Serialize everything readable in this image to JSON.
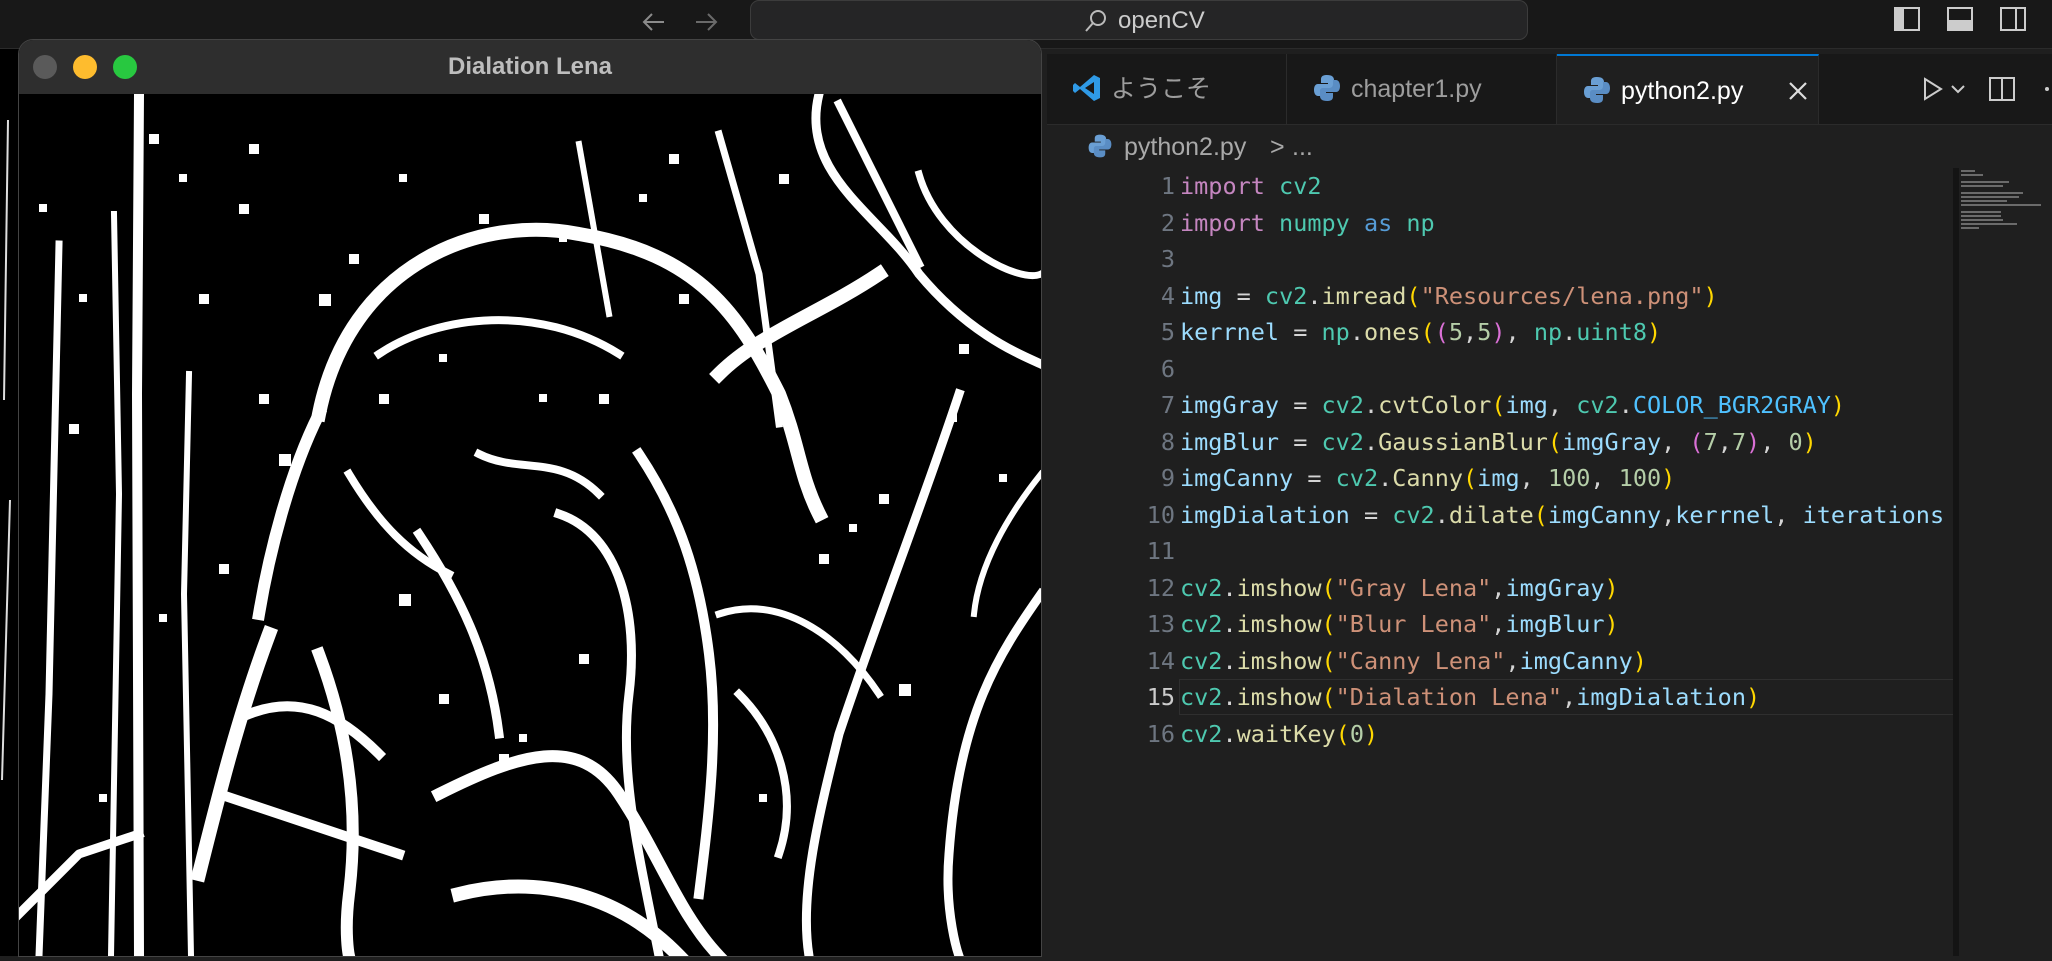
{
  "titlebar": {
    "search_text": "openCV"
  },
  "cv_window": {
    "title": "Dialation Lena"
  },
  "tabs": [
    {
      "label": "ようこそ",
      "icon": "vscode-logo-icon",
      "active": false
    },
    {
      "label": "chapter1.py",
      "icon": "python-file-icon",
      "active": false
    },
    {
      "label": "python2.py",
      "icon": "python-file-icon",
      "active": true
    }
  ],
  "breadcrumb": {
    "file": "python2.py",
    "separator": ">",
    "more": "..."
  },
  "editor": {
    "current_line": 15,
    "lines": [
      {
        "n": "1",
        "text": "import cv2"
      },
      {
        "n": "2",
        "text": "import numpy as np"
      },
      {
        "n": "3",
        "text": ""
      },
      {
        "n": "4",
        "text": "img = cv2.imread(\"Resources/lena.png\")"
      },
      {
        "n": "5",
        "text": "kerrnel = np.ones((5,5), np.uint8)"
      },
      {
        "n": "6",
        "text": ""
      },
      {
        "n": "7",
        "text": "imgGray = cv2.cvtColor(img, cv2.COLOR_BGR2GRAY)"
      },
      {
        "n": "8",
        "text": "imgBlur = cv2.GaussianBlur(imgGray, (7,7), 0)"
      },
      {
        "n": "9",
        "text": "imgCanny = cv2.Canny(img, 100, 100)"
      },
      {
        "n": "10",
        "text": "imgDialation = cv2.dilate(imgCanny,kerrnel, iterations"
      },
      {
        "n": "11",
        "text": ""
      },
      {
        "n": "12",
        "text": "cv2.imshow(\"Gray Lena\",imgGray)"
      },
      {
        "n": "13",
        "text": "cv2.imshow(\"Blur Lena\",imgBlur)"
      },
      {
        "n": "14",
        "text": "cv2.imshow(\"Canny Lena\",imgCanny)"
      },
      {
        "n": "15",
        "text": "cv2.imshow(\"Dialation Lena\",imgDialation)"
      },
      {
        "n": "16",
        "text": "cv2.waitKey(0)"
      }
    ]
  },
  "colors": {
    "accent": "#0078d4",
    "traffic_close": "#ff5f57",
    "traffic_min": "#febc2e",
    "traffic_max": "#28c840"
  }
}
